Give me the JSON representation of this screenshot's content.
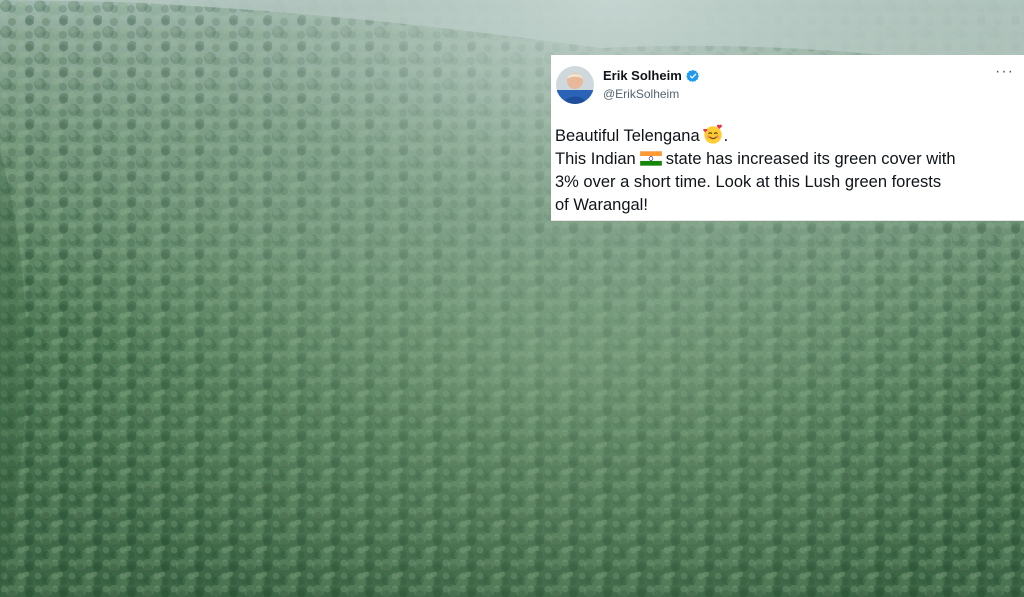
{
  "tweet": {
    "author_name": "Erik Solheim",
    "author_handle": "@ErikSolheim",
    "more_label": "···",
    "line1_text": "Beautiful Telengana",
    "line1_suffix": ".",
    "line2_before_flag": "This Indian",
    "line2_after_flag": "state has increased its green cover with",
    "line3": "3% over a short time. Look  at this Lush green forests",
    "line4": "of Warangal!",
    "icons": [
      "verified-badge-icon",
      "smiling-face-with-hearts-icon",
      "india-flag-icon",
      "more-options-icon"
    ]
  },
  "colors": {
    "verified": "#1d9bf0",
    "text": "#0f1419",
    "handle": "#536471",
    "forest_dark": "#3f6a47",
    "forest_light": "#7fa088",
    "sky_haze": "#b9c9c6"
  }
}
